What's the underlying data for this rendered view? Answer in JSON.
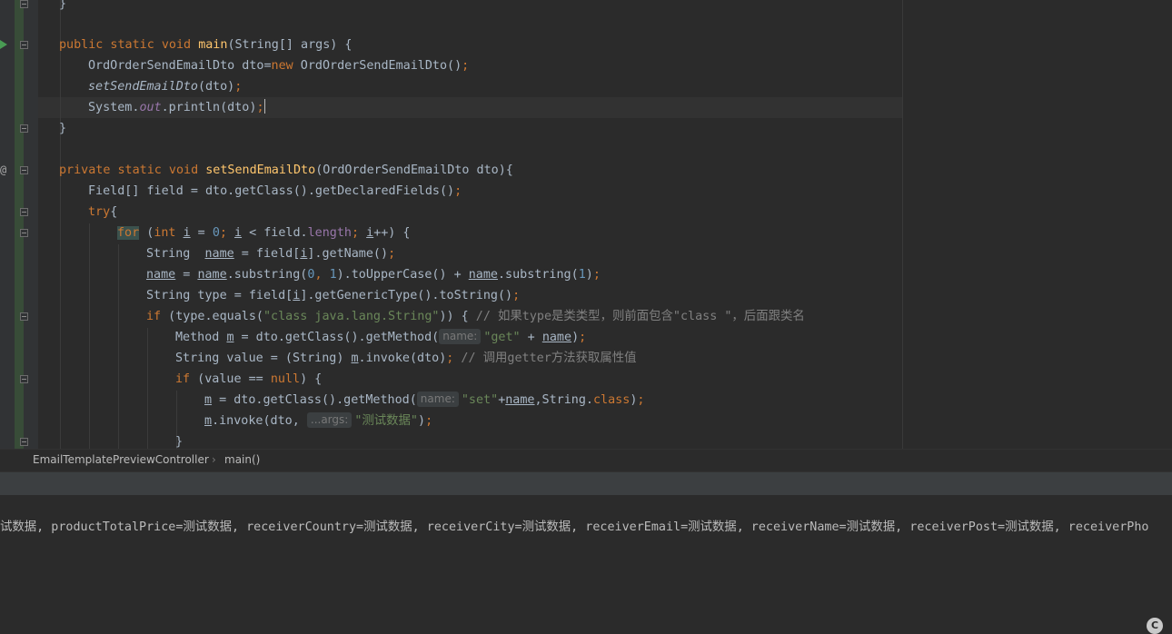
{
  "editor": {
    "line_prev_close": "}",
    "main_sig": {
      "kw": "public static void ",
      "name": "main",
      "params": "(String[] args) {"
    },
    "main_body": {
      "l1_a": "OrdOrderSendEmailDto dto=",
      "l1_kw": "new",
      "l1_b": " OrdOrderSendEmailDto()",
      "l1_semi": ";",
      "l2_call": "setSendEmailDto",
      "l2_args": "(dto)",
      "l2_semi": ";",
      "l3_a": "System.",
      "l3_out": "out",
      "l3_b": ".println(dto)",
      "l3_semi": ";"
    },
    "main_close": "}",
    "method_sig": {
      "kw": "private static void ",
      "name": "setSendEmailDto",
      "params": "(OrdOrderSendEmailDto dto){"
    },
    "body": {
      "field_a": "Field[] field = dto.getClass().getDeclaredFields()",
      "semi": ";",
      "try_kw": "try",
      "try_brace": "{",
      "for_kw": "for",
      "for_open": " (",
      "for_int": "int",
      "i": "i",
      "eq": " = ",
      "zero": "0",
      "lt": " < field.",
      "length": "length",
      "inc": "++) {",
      "s1_a": "String  ",
      "name_var": "name",
      "s1_b": " = field[",
      "s1_c": "].getName()",
      "s2_eq": " = ",
      "s2_a": ".substring(",
      "one": "1",
      "s2_b": ").toUpperCase() + ",
      "s2_c": ".substring(",
      "s2_d": ")",
      "comma": ", ",
      "s3_a": "String type = field[",
      "s3_b": "].getGenericType().toString()",
      "if_kw": "if",
      "if_a": " (type.equals(",
      "if_str": "\"class java.lang.String\"",
      "if_b": ")) { ",
      "if_cmt": "// 如果type是类类型，则前面包含\"class \"，后面跟类名",
      "m_var": "m",
      "m1_a": "Method ",
      "m1_b": " = dto.getClass().getMethod(",
      "hint_name": "name:",
      "get_str": "\"get\"",
      "m1_plus": " + ",
      "m1_c": ")",
      "v1_a": "String value = (String) ",
      "v1_b": ".invoke(dto)",
      "v1_cmt": " // 调用getter方法获取属性值",
      "if2_a": " (value == ",
      "null_kw": "null",
      "if2_b": ") {",
      "m2_a": " = dto.getClass().getMethod(",
      "set_str": "\"set\"",
      "m2_b": "+",
      "m2_c": ",String.",
      "class_kw": "class",
      "m2_d": ")",
      "inv_a": ".invoke(dto, ",
      "hint_args": "...args:",
      "inv_str": "\"测试数据\"",
      "inv_b": ")",
      "close_brace": "}"
    }
  },
  "breadcrumb": {
    "class_name": "EmailTemplatePreviewController",
    "separator": "›",
    "method": "main()"
  },
  "console": {
    "output": "试数据, productTotalPrice=测试数据, receiverCountry=测试数据, receiverCity=测试数据, receiverEmail=测试数据, receiverName=测试数据, receiverPost=测试数据, receiverPho"
  },
  "status_badge": "C",
  "icons": {
    "run": "run-gutter-icon",
    "override": "override-gutter-icon",
    "fold": "fold-icon"
  },
  "colors": {
    "keyword": "#cc7832",
    "method": "#ffc66d",
    "string": "#6a8759",
    "number": "#6897bb",
    "field": "#9876aa",
    "comment": "#808080",
    "text": "#a9b7c6",
    "background": "#2b2b2b"
  }
}
